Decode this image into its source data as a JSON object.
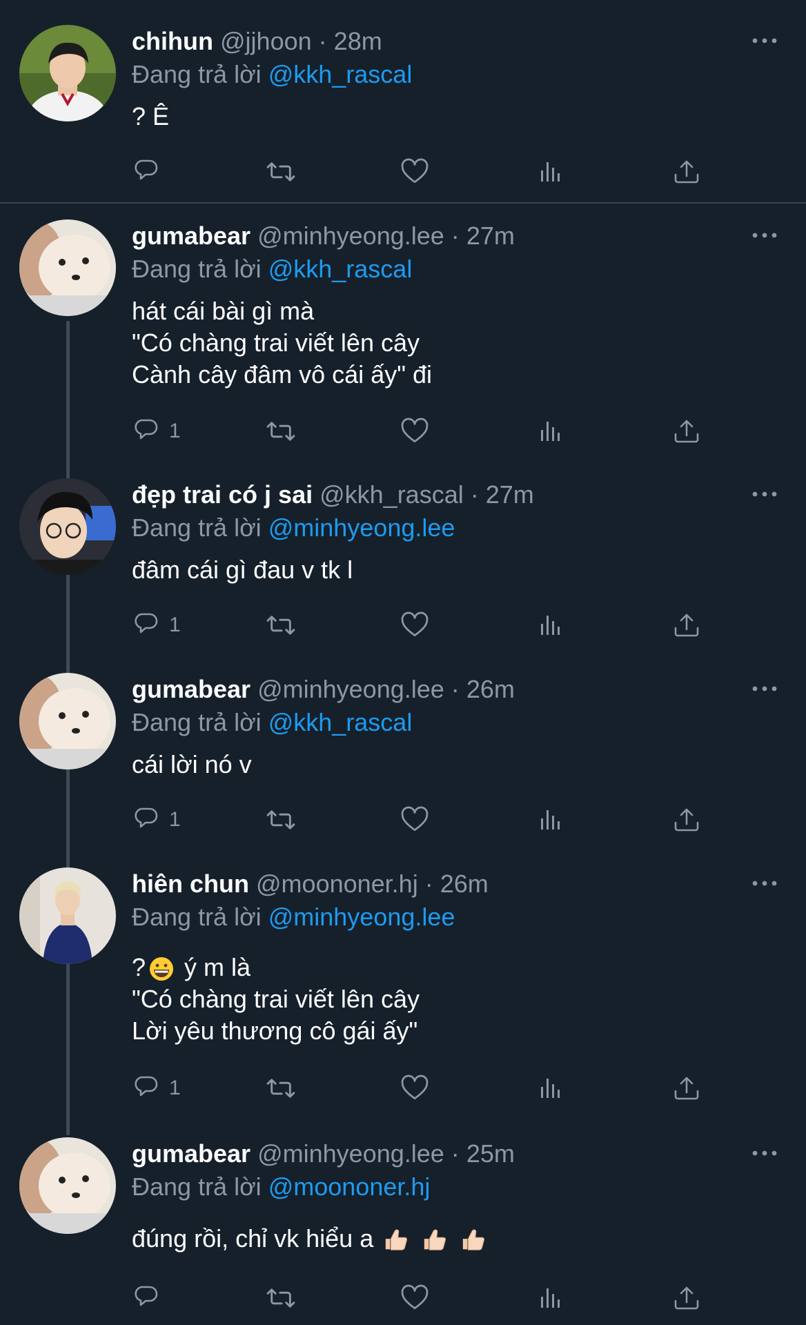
{
  "colors": {
    "background": "#15202b",
    "muted": "#8b98a5",
    "link": "#1d9bf0",
    "divider": "#38444d"
  },
  "icons": {
    "reply": "speech-bubble-icon",
    "retweet": "retweet-icon",
    "like": "heart-icon",
    "views": "bar-chart-icon",
    "share": "share-icon",
    "more": "more-dots-icon"
  },
  "tweets": [
    {
      "name": "chihun",
      "handle": "@jjhoon",
      "sep": "·",
      "time": "28m",
      "reply_prefix": "Đang trả lời",
      "reply_to": "@kkh_rascal",
      "lines": [
        "? Ê"
      ],
      "reply_count": ""
    },
    {
      "name": "gumabear",
      "handle": "@minhyeong.lee",
      "sep": "·",
      "time": "27m",
      "reply_prefix": "Đang trả lời",
      "reply_to": "@kkh_rascal",
      "lines": [
        "hát cái bài gì mà",
        "\"Có chàng trai viết lên cây",
        "Cành cây đâm vô cái ấy\" đi"
      ],
      "reply_count": "1"
    },
    {
      "name": "đẹp trai có j sai",
      "handle": "@kkh_rascal",
      "sep": "·",
      "time": "27m",
      "reply_prefix": "Đang trả lời",
      "reply_to": "@minhyeong.lee",
      "lines": [
        "đâm cái gì đau v tk l"
      ],
      "reply_count": "1"
    },
    {
      "name": "gumabear",
      "handle": "@minhyeong.lee",
      "sep": "·",
      "time": "26m",
      "reply_prefix": "Đang trả lời",
      "reply_to": "@kkh_rascal",
      "lines": [
        "cái lời nó v"
      ],
      "reply_count": "1"
    },
    {
      "name": "hiên chun",
      "handle": "@moononer.hj",
      "sep": "·",
      "time": "26m",
      "reply_prefix": "Đang trả lời",
      "reply_to": "@minhyeong.lee",
      "first_line_a": "?",
      "first_line_b": "ý m là",
      "lines": [
        "\"Có chàng trai viết lên cây",
        "Lời yêu thương cô gái ấy\""
      ],
      "reply_count": "1"
    },
    {
      "name": "gumabear",
      "handle": "@minhyeong.lee",
      "sep": "·",
      "time": "25m",
      "reply_prefix": "Đang trả lời",
      "reply_to": "@moononer.hj",
      "first_line_a": "đúng rồi, chỉ vk hiểu a",
      "lines": [],
      "reply_count": ""
    }
  ]
}
